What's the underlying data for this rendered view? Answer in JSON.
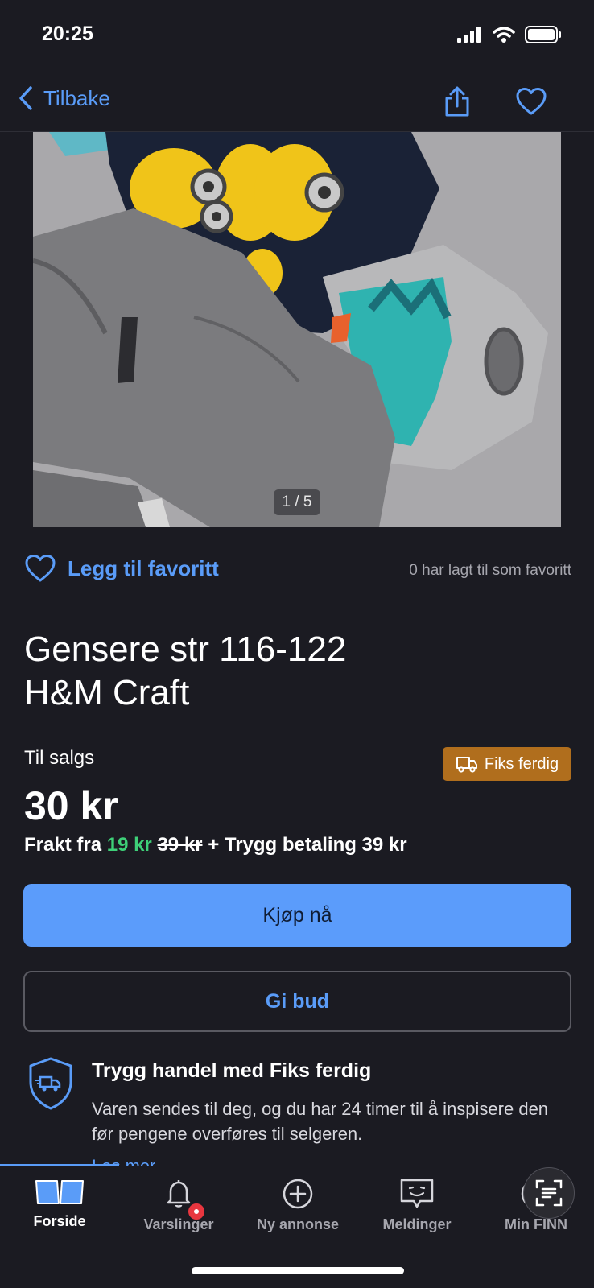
{
  "status": {
    "time": "20:25"
  },
  "nav": {
    "back_label": "Tilbake"
  },
  "photo": {
    "counter": "1 / 5"
  },
  "favorite": {
    "add_label": "Legg til favoritt",
    "count_text": "0 har lagt til som favoritt"
  },
  "listing": {
    "title_line1": "Gensere str 116-122",
    "title_line2": "H&M Craft",
    "status": "Til salgs",
    "price": "30 kr",
    "badge": "Fiks ferdig",
    "shipping_prefix": "Frakt fra",
    "shipping_price": "19 kr",
    "shipping_old_price": "39 kr",
    "shipping_suffix": "+ Trygg betaling 39 kr"
  },
  "actions": {
    "buy_label": "Kjøp nå",
    "bid_label": "Gi bud"
  },
  "safe_trade": {
    "title": "Trygg handel med Fiks ferdig",
    "text": "Varen sendes til deg, og du har 24 timer til å inspisere den før pengene overføres til selgeren.",
    "read_more": "Les mer"
  },
  "tabs": [
    {
      "label": "Forside",
      "icon": "home-book-icon",
      "active": true
    },
    {
      "label": "Varslinger",
      "icon": "bell-icon",
      "active": false
    },
    {
      "label": "Ny annonse",
      "icon": "plus-circle-icon",
      "active": false
    },
    {
      "label": "Meldinger",
      "icon": "chat-icon",
      "active": false
    },
    {
      "label": "Min FINN",
      "icon": "profile-icon",
      "active": false
    }
  ],
  "colors": {
    "accent": "#5a9cf8",
    "background": "#1b1b22",
    "badge": "#b06e1d",
    "discount": "#3ecf78",
    "notification": "#e8363f"
  }
}
